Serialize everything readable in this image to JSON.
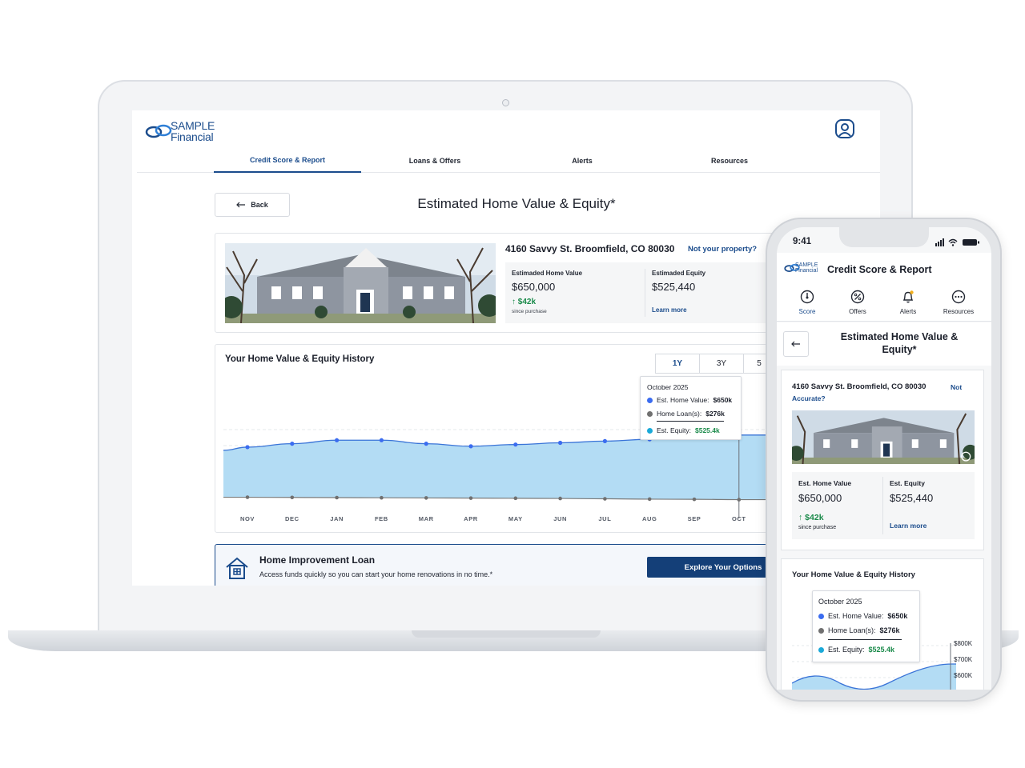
{
  "brand": {
    "line1": "SAMPLE",
    "line2": "Financial",
    "color": "#1b4c8c"
  },
  "laptop": {
    "nav": [
      {
        "label": "Credit Score & Report",
        "active": true
      },
      {
        "label": "Loans & Offers",
        "active": false
      },
      {
        "label": "Alerts",
        "active": false
      },
      {
        "label": "Resources",
        "active": false
      }
    ],
    "back_label": "Back",
    "page_title": "Estimated Home Value & Equity*",
    "property": {
      "address": "4160 Savvy St. Broomfield, CO 80030",
      "not_yours": "Not your property?",
      "home_value_label": "Estimaded Home Value",
      "home_value": "$650,000",
      "change": "$42k",
      "since": "since purchase",
      "equity_label": "Estimaded Equity",
      "equity": "$525,440",
      "learn_more": "Learn more"
    },
    "history": {
      "title": "Your Home Value & Equity History",
      "ranges": [
        "1Y",
        "3Y",
        "5"
      ],
      "active_range": "1Y",
      "tooltip": {
        "month": "October 2025",
        "home_value_label": "Est. Home Value:",
        "home_value": "$650k",
        "loan_label": "Home Loan(s):",
        "loan": "$276k",
        "equity_label": "Est. Equity:",
        "equity": "$525.4k"
      }
    },
    "promo": {
      "title": "Home Improvement Loan",
      "subtitle": "Access funds quickly so you can start your home renovations in no time.*",
      "button": "Explore Your Options"
    }
  },
  "chart_data": {
    "type": "area",
    "categories": [
      "NOV",
      "DEC",
      "JAN",
      "FEB",
      "MAR",
      "APR",
      "MAY",
      "JUN",
      "JUL",
      "AUG",
      "SEP",
      "OCT"
    ],
    "series": [
      {
        "values": [
          0.58,
          0.6,
          0.62,
          0.62,
          0.6,
          0.585,
          0.595,
          0.605,
          0.615,
          0.625,
          0.635,
          0.65
        ],
        "color": "#3b6cf0"
      },
      {
        "values": [
          0.29,
          0.289,
          0.288,
          0.287,
          0.286,
          0.285,
          0.284,
          0.283,
          0.281,
          0.279,
          0.278,
          0.276
        ],
        "color": "#707070"
      }
    ],
    "fill_color": "#b3dcf4",
    "highlight": "OCT",
    "grid": true
  },
  "phone": {
    "time": "9:41",
    "header_title": "Credit Score & Report",
    "tabs": [
      {
        "label": "Score",
        "icon": "score-gauge-icon",
        "active": true
      },
      {
        "label": "Offers",
        "icon": "percent-badge-icon",
        "active": false
      },
      {
        "label": "Alerts",
        "icon": "bell-icon",
        "active": false
      },
      {
        "label": "Resources",
        "icon": "more-dots-icon",
        "active": false
      }
    ],
    "page_title_line1": "Estimated Home Value &",
    "page_title_line2": "Equity*",
    "address": "4160 Savvy St. Broomfield, CO 80030",
    "not_accurate_1": "Not",
    "not_accurate_2": "Accurate?",
    "home_value_label": "Est. Home Value",
    "home_value": "$650,000",
    "change": "$42k",
    "since": "since purchase",
    "equity_label": "Est. Equity",
    "equity": "$525,440",
    "learn_more": "Learn more",
    "history_title": "Your Home Value & Equity History",
    "tooltip": {
      "month": "October 2025",
      "home_value_label": "Est. Home Value:",
      "home_value": "$650k",
      "loan_label": "Home Loan(s):",
      "loan": "$276k",
      "equity_label": "Est. Equity:",
      "equity": "$525.4k"
    },
    "y_ticks": [
      "$800K",
      "$700K",
      "$600K"
    ]
  },
  "colors": {
    "navy": "#1b4c8c",
    "button": "#143f78",
    "green": "#1a8a4a",
    "value_dot": "#3b6cf0",
    "loan_dot": "#707070",
    "equity_dot": "#1aa9d8"
  }
}
